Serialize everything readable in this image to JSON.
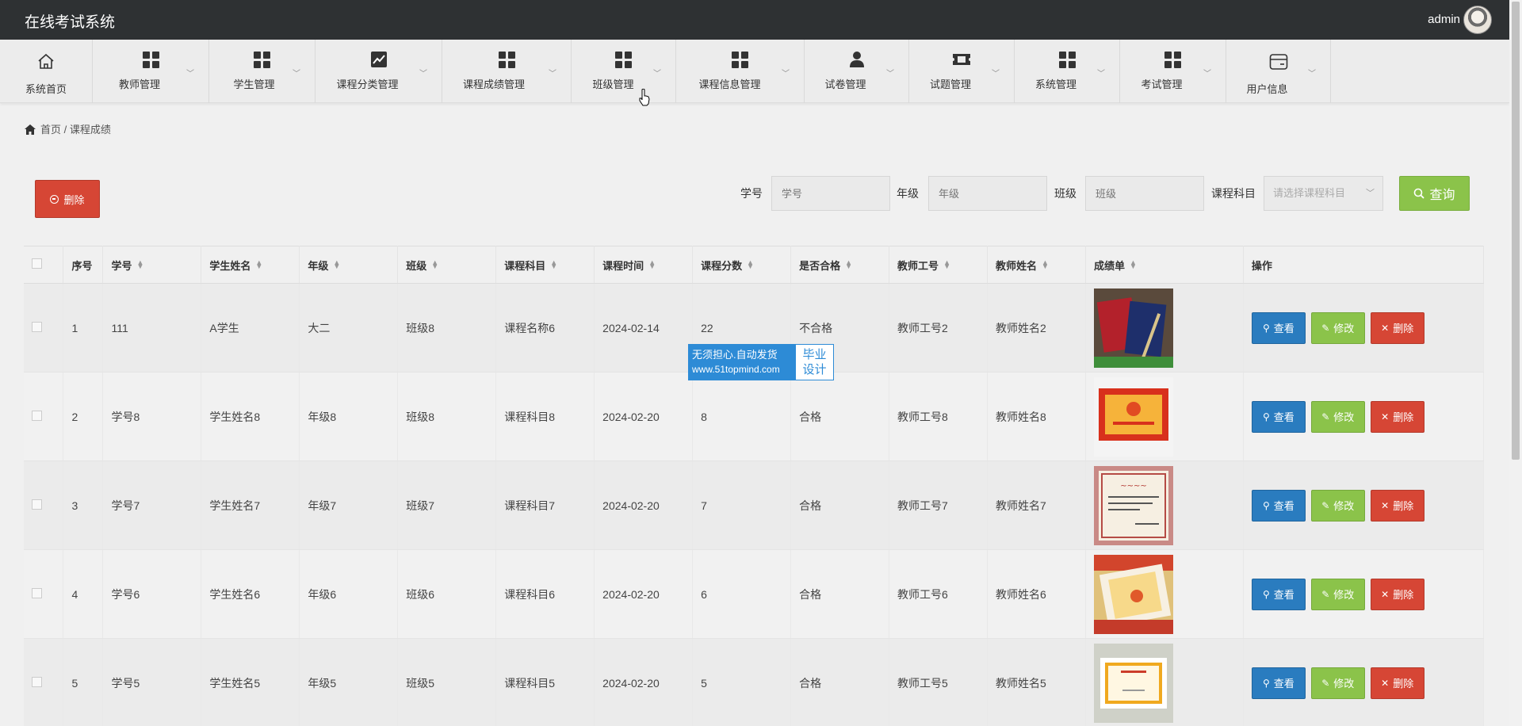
{
  "app": {
    "title": "在线考试系统",
    "user": "admin"
  },
  "nav": [
    {
      "label": "系统首页",
      "icon": "home-icon"
    },
    {
      "label": "教师管理",
      "icon": "grid-icon"
    },
    {
      "label": "学生管理",
      "icon": "grid-icon"
    },
    {
      "label": "课程分类管理",
      "icon": "chart-icon"
    },
    {
      "label": "课程成绩管理",
      "icon": "grid-icon"
    },
    {
      "label": "班级管理",
      "icon": "grid-icon"
    },
    {
      "label": "课程信息管理",
      "icon": "grid-icon"
    },
    {
      "label": "试卷管理",
      "icon": "user-icon"
    },
    {
      "label": "试题管理",
      "icon": "ticket-icon"
    },
    {
      "label": "系统管理",
      "icon": "grid-icon"
    },
    {
      "label": "考试管理",
      "icon": "grid-icon"
    },
    {
      "label": "用户信息",
      "icon": "card-icon"
    }
  ],
  "breadcrumb": {
    "home": "首页",
    "separator": "/",
    "current": "课程成绩"
  },
  "toolbar": {
    "delete_label": "删除",
    "query_label": "查询"
  },
  "filters": {
    "student_no": {
      "label": "学号",
      "placeholder": "学号"
    },
    "grade": {
      "label": "年级",
      "placeholder": "年级"
    },
    "class": {
      "label": "班级",
      "placeholder": "班级"
    },
    "subject": {
      "label": "课程科目",
      "placeholder": "请选择课程科目"
    }
  },
  "table": {
    "headers": [
      "序号",
      "学号",
      "学生姓名",
      "年级",
      "班级",
      "课程科目",
      "课程时间",
      "课程分数",
      "是否合格",
      "教师工号",
      "教师姓名",
      "成绩单",
      "操作"
    ],
    "rows": [
      {
        "index": "1",
        "student_no": "111",
        "name": "A学生",
        "grade": "大二",
        "class": "班级8",
        "subject": "课程名称6",
        "time": "2024-02-14",
        "score": "22",
        "pass": "不合格",
        "teacher_no": "教师工号2",
        "teacher_name": "教师姓名2",
        "image": "book-cover"
      },
      {
        "index": "2",
        "student_no": "学号8",
        "name": "学生姓名8",
        "grade": "年级8",
        "class": "班级8",
        "subject": "课程科目8",
        "time": "2024-02-20",
        "score": "8",
        "pass": "合格",
        "teacher_no": "教师工号8",
        "teacher_name": "教师姓名8",
        "image": "certificate-red"
      },
      {
        "index": "3",
        "student_no": "学号7",
        "name": "学生姓名7",
        "grade": "年级7",
        "class": "班级7",
        "subject": "课程科目7",
        "time": "2024-02-20",
        "score": "7",
        "pass": "合格",
        "teacher_no": "教师工号7",
        "teacher_name": "教师姓名7",
        "image": "certificate-pink"
      },
      {
        "index": "4",
        "student_no": "学号6",
        "name": "学生姓名6",
        "grade": "年级6",
        "class": "班级6",
        "subject": "课程科目6",
        "time": "2024-02-20",
        "score": "6",
        "pass": "合格",
        "teacher_no": "教师工号6",
        "teacher_name": "教师姓名6",
        "image": "certificate-orange"
      },
      {
        "index": "5",
        "student_no": "学号5",
        "name": "学生姓名5",
        "grade": "年级5",
        "class": "班级5",
        "subject": "课程科目5",
        "time": "2024-02-20",
        "score": "5",
        "pass": "合格",
        "teacher_no": "教师工号5",
        "teacher_name": "教师姓名5",
        "image": "certificate-white"
      }
    ],
    "actions": {
      "view": "查看",
      "edit": "修改",
      "delete": "删除"
    }
  },
  "watermark": {
    "line1": "无须担心.自动发货",
    "line2": "www.51topmind.com",
    "side1": "毕业",
    "side2": "设计"
  },
  "colors": {
    "header": "#2e3133",
    "danger": "#d64635",
    "primary": "#2a7cbf",
    "success": "#8bc34a"
  }
}
